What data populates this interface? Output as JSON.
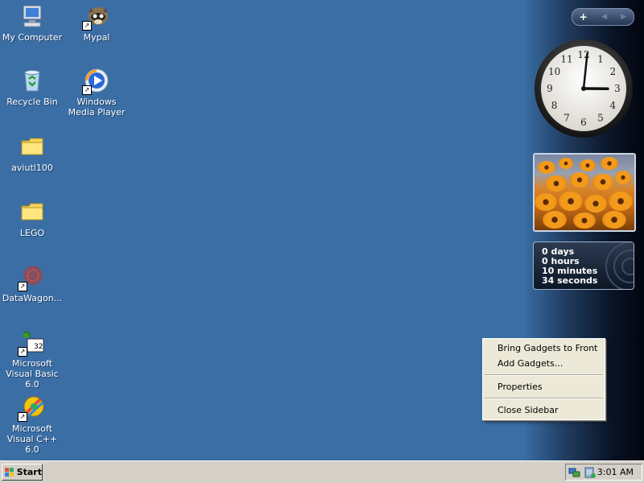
{
  "desktop": {
    "background_color": "#3a6ea5",
    "icons": [
      {
        "label": "My Computer",
        "icon": "computer-icon"
      },
      {
        "label": "Mypal",
        "icon": "raccoon-icon"
      },
      {
        "label": "Recycle Bin",
        "icon": "recycle-bin-icon"
      },
      {
        "label": "Windows Media Player",
        "icon": "media-player-icon"
      },
      {
        "label": "aviutl100",
        "icon": "folder-icon"
      },
      {
        "label": "LEGO",
        "icon": "folder-icon"
      },
      {
        "label": "DataWagon...",
        "icon": "datawagon-icon"
      },
      {
        "label": "Microsoft Visual Basic 6.0",
        "icon": "visual-basic-icon"
      },
      {
        "label": "Microsoft Visual C++ 6.0",
        "icon": "visual-cpp-icon"
      }
    ]
  },
  "sidebar": {
    "controls": {
      "add": "+",
      "prev": "◀",
      "next": "▶"
    },
    "clock": {
      "numbers": [
        "12",
        "1",
        "2",
        "3",
        "4",
        "5",
        "6",
        "7",
        "8",
        "9",
        "10",
        "11"
      ],
      "hour": 3,
      "minute": 1
    },
    "uptime": {
      "days": "0 days",
      "hours": "0 hours",
      "minutes": "10 minutes",
      "seconds": "34 seconds"
    }
  },
  "context_menu": {
    "items": [
      "Bring Gadgets to Front",
      "Add Gadgets...",
      "Properties",
      "Close Sidebar"
    ]
  },
  "taskbar": {
    "start_label": "Start",
    "time": "3:01 AM"
  }
}
